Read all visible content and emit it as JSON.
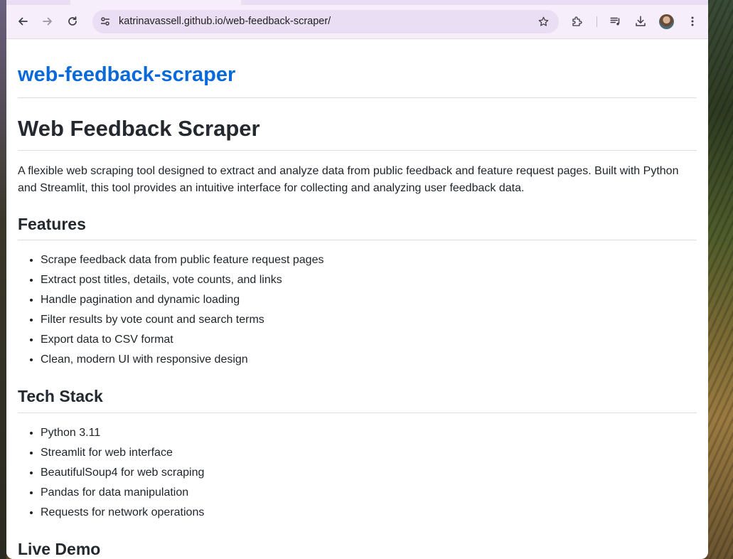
{
  "browser": {
    "url": "katrinavassell.github.io/web-feedback-scraper/"
  },
  "page": {
    "site_title": "web-feedback-scraper",
    "heading": "Web Feedback Scraper",
    "intro": "A flexible web scraping tool designed to extract and analyze data from public feedback and feature request pages. Built with Python and Streamlit, this tool provides an intuitive interface for collecting and analyzing user feedback data.",
    "features_heading": "Features",
    "features": [
      "Scrape feedback data from public feature request pages",
      "Extract post titles, details, vote counts, and links",
      "Handle pagination and dynamic loading",
      "Filter results by vote count and search terms",
      "Export data to CSV format",
      "Clean, modern UI with responsive design"
    ],
    "tech_heading": "Tech Stack",
    "tech": [
      "Python 3.11",
      "Streamlit for web interface",
      "BeautifulSoup4 for web scraping",
      "Pandas for data manipulation",
      "Requests for network operations"
    ],
    "demo_heading": "Live Demo"
  },
  "colors": {
    "link": "#0969da",
    "text": "#24292f",
    "chrome_toolbar": "#f6eefb",
    "omnibox": "#e9def3"
  }
}
